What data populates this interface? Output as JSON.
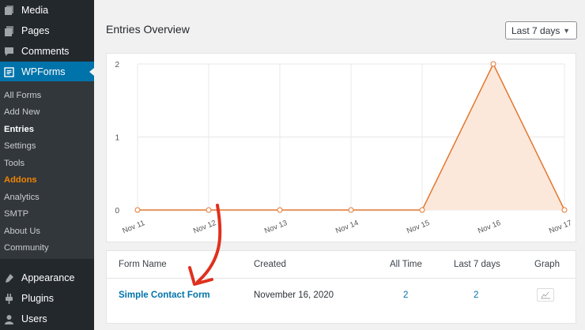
{
  "sidebar": {
    "top_items": [
      {
        "label": "Media",
        "icon": "media-icon"
      },
      {
        "label": "Pages",
        "icon": "pages-icon"
      },
      {
        "label": "Comments",
        "icon": "comments-icon"
      },
      {
        "label": "WPForms",
        "icon": "wpforms-icon"
      }
    ],
    "submenu": [
      "All Forms",
      "Add New",
      "Entries",
      "Settings",
      "Tools",
      "Addons",
      "Analytics",
      "SMTP",
      "About Us",
      "Community"
    ],
    "bottom_items": [
      {
        "label": "Appearance",
        "icon": "appearance-icon"
      },
      {
        "label": "Plugins",
        "icon": "plugins-icon"
      },
      {
        "label": "Users",
        "icon": "users-icon"
      }
    ]
  },
  "header": {
    "title": "Entries Overview",
    "range_selected": "Last 7 days"
  },
  "chart_data": {
    "type": "area",
    "categories": [
      "Nov 11",
      "Nov 12",
      "Nov 13",
      "Nov 14",
      "Nov 15",
      "Nov 16",
      "Nov 17"
    ],
    "values": [
      0,
      0,
      0,
      0,
      0,
      2,
      0
    ],
    "yticks": [
      "0",
      "1",
      "2"
    ],
    "ylim": [
      0,
      2
    ],
    "grid": true,
    "line_color": "#e27730",
    "fill_color": "#fce8da"
  },
  "table": {
    "headers": [
      "Form Name",
      "Created",
      "All Time",
      "Last 7 days",
      "Graph"
    ],
    "rows": [
      {
        "form_name": "Simple Contact Form",
        "created": "November 16, 2020",
        "all_time": "2",
        "last_7_days": "2"
      }
    ]
  },
  "annotation": {
    "arrow_color": "#e0301e"
  }
}
